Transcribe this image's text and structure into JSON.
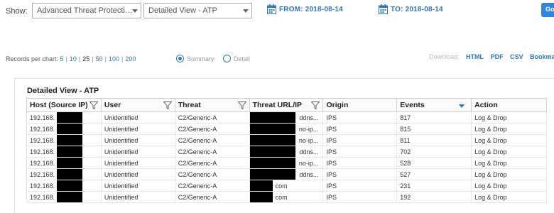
{
  "toolbar": {
    "show_label": "Show:",
    "report_select": "Advanced Threat Protecti…",
    "view_select": "Detailed View - ATP",
    "from_date": "FROM: 2018-08-14",
    "to_date": "TO: 2018-08-14",
    "go_button": "Go"
  },
  "records": {
    "label": "Records per chart:",
    "options": [
      "5",
      "10",
      "25",
      "50",
      "100",
      "200"
    ],
    "selected": "25"
  },
  "view_mode": {
    "summary_label": "Summary",
    "detail_label": "Detail",
    "selected": "Summary"
  },
  "download": {
    "label": "Download:",
    "links": [
      "HTML",
      "PDF",
      "CSV",
      "Bookmark"
    ]
  },
  "table": {
    "title": "Detailed View - ATP",
    "columns": [
      "Host (Source IP)",
      "User",
      "Threat",
      "Threat URL/IP",
      "Origin",
      "Events",
      "Action"
    ],
    "sorted_column": "Events",
    "rows": [
      {
        "host": "192.168.",
        "user": "Unidentified",
        "threat": "C2/Generic-A",
        "url": "ddns...",
        "origin": "IPS",
        "events": "817",
        "action": "Log & Drop"
      },
      {
        "host": "192.168.",
        "user": "Unidentified",
        "threat": "C2/Generic-A",
        "url": "no-ip...",
        "origin": "IPS",
        "events": "815",
        "action": "Log & Drop"
      },
      {
        "host": "192.168.",
        "user": "Unidentified",
        "threat": "C2/Generic-A",
        "url": "no-ip...",
        "origin": "IPS",
        "events": "811",
        "action": "Log & Drop"
      },
      {
        "host": "192.168.",
        "user": "Unidentified",
        "threat": "C2/Generic-A",
        "url": "ddns...",
        "origin": "IPS",
        "events": "702",
        "action": "Log & Drop"
      },
      {
        "host": "192.168.",
        "user": "Unidentified",
        "threat": "C2/Generic-A",
        "url": "no-ip...",
        "origin": "IPS",
        "events": "528",
        "action": "Log & Drop"
      },
      {
        "host": "192.168.",
        "user": "Unidentified",
        "threat": "C2/Generic-A",
        "url": "ddns...",
        "origin": "IPS",
        "events": "527",
        "action": "Log & Drop"
      },
      {
        "host": "192.168.",
        "user": "Unidentified",
        "threat": "C2/Generic-A",
        "url": "com",
        "origin": "IPS",
        "events": "231",
        "action": "Log & Drop"
      },
      {
        "host": "192.168.",
        "user": "Unidentified",
        "threat": "C2/Generic-A",
        "url": "com",
        "origin": "IPS",
        "events": "192",
        "action": "Log & Drop"
      }
    ]
  }
}
